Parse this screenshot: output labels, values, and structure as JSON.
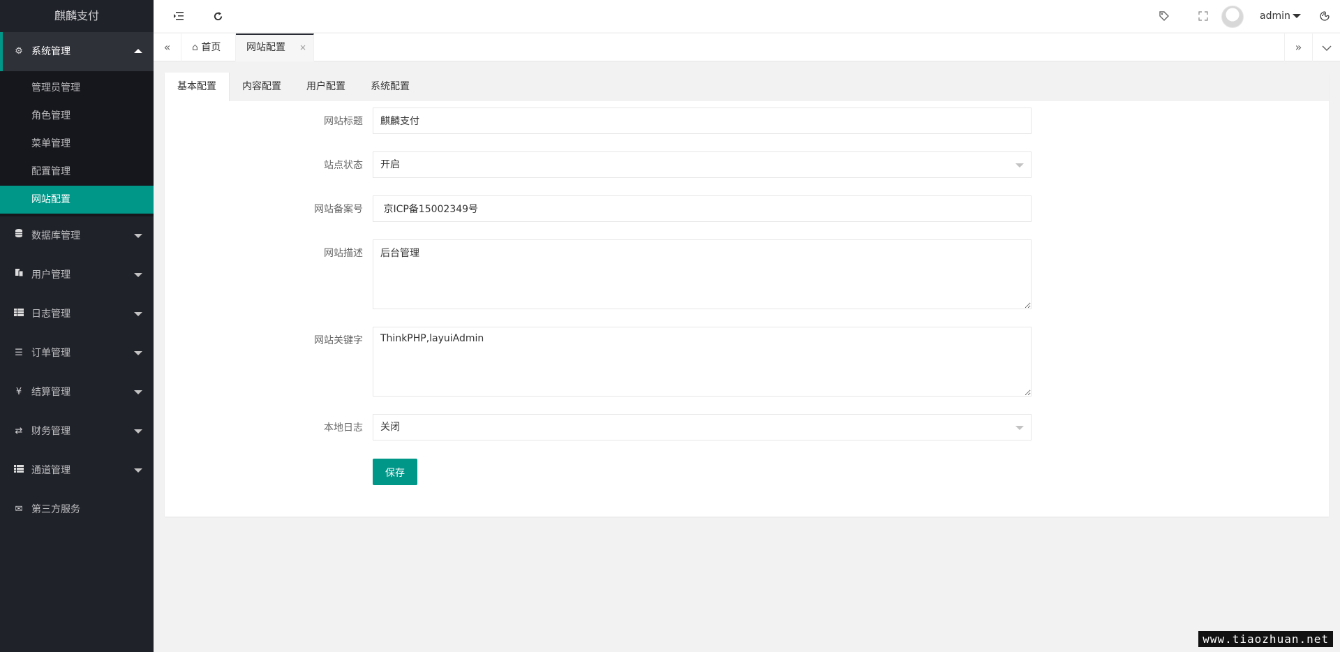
{
  "app": {
    "title": "麒麟支付"
  },
  "colors": {
    "accent": "#009688",
    "sidebar_bg": "#20222a"
  },
  "sidebar": {
    "items": [
      {
        "label": "系统管理",
        "icon": "gear-icon",
        "open": true,
        "children": [
          "管理员管理",
          "角色管理",
          "菜单管理",
          "配置管理",
          "网站配置"
        ],
        "active_child": "网站配置"
      },
      {
        "label": "数据库管理",
        "icon": "database-icon"
      },
      {
        "label": "用户管理",
        "icon": "users-icon"
      },
      {
        "label": "日志管理",
        "icon": "log-icon"
      },
      {
        "label": "订单管理",
        "icon": "list-icon"
      },
      {
        "label": "结算管理",
        "icon": "yen-icon"
      },
      {
        "label": "财务管理",
        "icon": "transfer-icon"
      },
      {
        "label": "通道管理",
        "icon": "channel-icon"
      },
      {
        "label": "第三方服务",
        "icon": "mail-icon"
      }
    ]
  },
  "header": {
    "user": "admin",
    "icons": [
      "menu-collapse-icon",
      "refresh-icon",
      "tag-icon",
      "fullscreen-icon",
      "theme-icon"
    ]
  },
  "page_tabs": {
    "home": "首页",
    "current": "网站配置",
    "close_glyph": "×"
  },
  "card_tabs": [
    "基本配置",
    "内容配置",
    "用户配置",
    "系统配置"
  ],
  "form": {
    "site_title": {
      "label": "网站标题",
      "value": "麒麟支付"
    },
    "site_status": {
      "label": "站点状态",
      "value": "开启"
    },
    "icp": {
      "label": "网站备案号",
      "value": " 京ICP备15002349号"
    },
    "description": {
      "label": "网站描述",
      "value": "后台管理"
    },
    "keywords": {
      "label": "网站关键字",
      "value": "ThinkPHP,layuiAdmin"
    },
    "local_log": {
      "label": "本地日志",
      "value": "关闭"
    },
    "save_label": "保存"
  },
  "watermark": "www.tiaozhuan.net"
}
